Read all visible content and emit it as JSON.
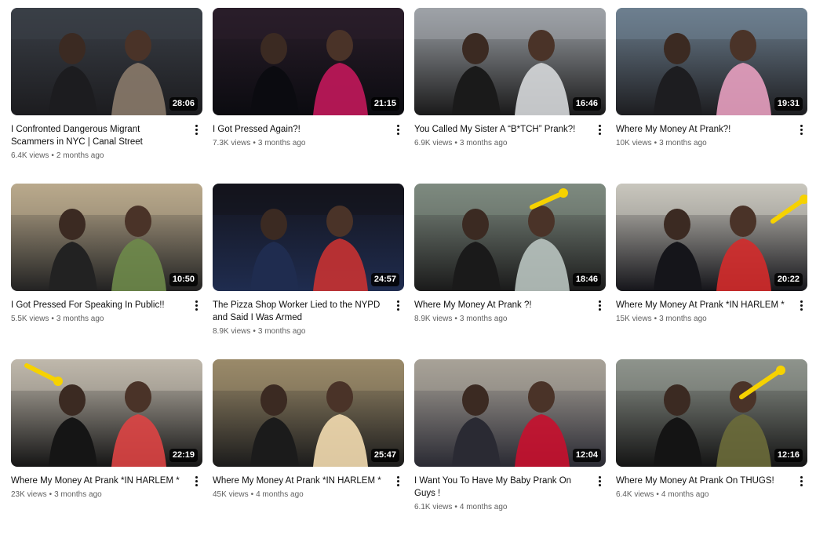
{
  "videos": [
    {
      "title": "I Confronted Dangerous Migrant Scammers in NYC | Canal Street",
      "views": "6.4K views",
      "age": "2 months ago",
      "duration": "28:06",
      "palette": [
        "#3a3f47",
        "#8a7a6a",
        "#1c1c1f"
      ]
    },
    {
      "title": "I Got Pressed Again?!",
      "views": "7.3K views",
      "age": "3 months ago",
      "duration": "21:15",
      "palette": [
        "#2a1e2a",
        "#c2185b",
        "#0b0b10"
      ]
    },
    {
      "title": "You Called My Sister A “B*TCH” Prank?!",
      "views": "6.9K views",
      "age": "3 months ago",
      "duration": "16:46",
      "palette": [
        "#9ea3a8",
        "#d6d8da",
        "#1a1a1a"
      ]
    },
    {
      "title": "Where My Money At Prank?!",
      "views": "10K views",
      "age": "3 months ago",
      "duration": "19:31",
      "palette": [
        "#6d7f8f",
        "#e8a0c0",
        "#1d1d20"
      ]
    },
    {
      "title": "I Got Pressed For Speaking In Public!!",
      "views": "5.5K views",
      "age": "3 months ago",
      "duration": "10:50",
      "palette": [
        "#b9a98c",
        "#6e8a4a",
        "#222"
      ]
    },
    {
      "title": "The Pizza Shop Worker Lied to the NYPD and Said I Was Armed",
      "views": "8.9K views",
      "age": "3 months ago",
      "duration": "24:57",
      "palette": [
        "#14141c",
        "#c83232",
        "#1f2c4f"
      ]
    },
    {
      "title": "Where My Money At Prank ?!",
      "views": "8.9K views",
      "age": "3 months ago",
      "duration": "18:46",
      "palette": [
        "#7e8a80",
        "#b9c4c0",
        "#1a1a1a"
      ]
    },
    {
      "title": "Where My Money At Prank *IN HARLEM *",
      "views": "15K views",
      "age": "3 months ago",
      "duration": "20:22",
      "palette": [
        "#c9c6bd",
        "#d42b2b",
        "#15151a"
      ]
    },
    {
      "title": "Where My Money At Prank *IN HARLEM *",
      "views": "23K views",
      "age": "3 months ago",
      "duration": "22:19",
      "palette": [
        "#bfb8ac",
        "#d44",
        "#151515"
      ]
    },
    {
      "title": "Where My Money At Prank *IN HARLEM *",
      "views": "45K views",
      "age": "4 months ago",
      "duration": "25:47",
      "palette": [
        "#9a8a6a",
        "#f3dcb0",
        "#1b1b1b"
      ]
    },
    {
      "title": "I Want You To Have My Baby Prank On Guys !",
      "views": "6.1K views",
      "age": "4 months ago",
      "duration": "12:04",
      "palette": [
        "#a8a298",
        "#c8102e",
        "#2a2a33"
      ]
    },
    {
      "title": "Where My Money At Prank On THUGS!",
      "views": "6.4K views",
      "age": "4 months ago",
      "duration": "12:16",
      "palette": [
        "#8e948c",
        "#6b6b3a",
        "#141414"
      ]
    }
  ],
  "separator": "•"
}
